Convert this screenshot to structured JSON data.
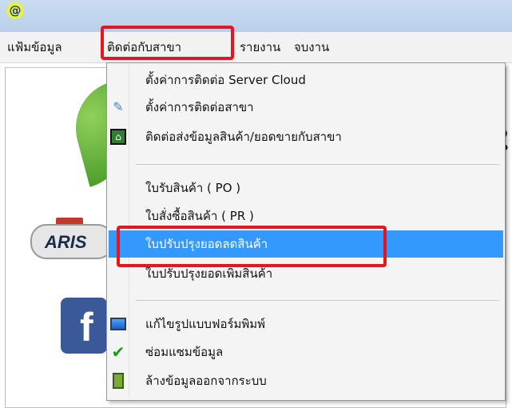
{
  "app": {
    "icon_glyph": "@"
  },
  "menubar": {
    "items": [
      {
        "label": "แฟ้มข้อมูล"
      },
      {
        "label": "ติดต่อกับสาขา"
      },
      {
        "label": "รายงาน"
      },
      {
        "label": "จบงาน"
      }
    ]
  },
  "background": {
    "logo_text": "ARIS",
    "facebook_letter": "f",
    "partial_glyph": "ใ"
  },
  "dropdown": {
    "items": [
      {
        "label": "ตั้งค่าการติดต่อ Server Cloud",
        "icon": ""
      },
      {
        "label": "ตั้งค่าการติดต่อสาขา",
        "icon": "wrench-icon",
        "glyph": "✎"
      },
      {
        "label": "ติดต่อส่งข้อมูลสินค้า/ยอดขายกับสาขา",
        "icon": "home-sync-icon",
        "glyph": "⌂"
      },
      {
        "label": "ใบรับสินค้า ( PO )",
        "icon": ""
      },
      {
        "label": "ใบสั่งซื้อสินค้า ( PR )",
        "icon": ""
      },
      {
        "label": "ใบปรับปรุงยอดลดสินค้า",
        "icon": "",
        "highlighted": true
      },
      {
        "label": "ใบปรับปรุงยอดเพิ่มสินค้า",
        "icon": ""
      },
      {
        "label": "แก้ไขรูปแบบฟอร์มพิมพ์",
        "icon": "monitor-icon"
      },
      {
        "label": "ซ่อมแซมข้อมูล",
        "icon": "checkmark-icon",
        "glyph": "✔"
      },
      {
        "label": "ล้างข้อมูลออกจากระบบ",
        "icon": "trash-icon"
      }
    ]
  },
  "colors": {
    "highlight": "#3399ff",
    "annotation_red": "#e8141f",
    "titlebar": "#c9dcf2"
  }
}
